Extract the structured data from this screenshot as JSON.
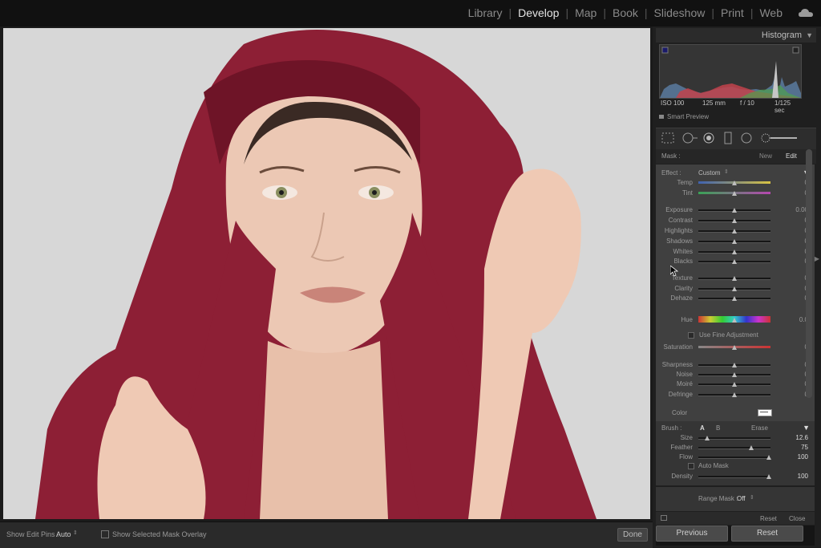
{
  "topbar": {
    "modules": [
      "Library",
      "Develop",
      "Map",
      "Book",
      "Slideshow",
      "Print",
      "Web"
    ],
    "active_module": "Develop",
    "cloud_icon": "cloud-icon"
  },
  "photo": {
    "background": "#d7d7d7",
    "scarf_color": "#8d1f35"
  },
  "bottombar": {
    "edit_pins_label": "Show Edit Pins :",
    "edit_pins_value": "Auto",
    "mask_overlay_label": "Show Selected Mask Overlay",
    "done_label": "Done"
  },
  "histogram": {
    "title": "Histogram",
    "iso": "ISO 100",
    "focal": "125 mm",
    "aperture": "f / 10",
    "shutter": "1/125 sec",
    "smart_preview": "Smart Preview"
  },
  "mask": {
    "label": "Mask :",
    "new_label": "New",
    "edit_label": "Edit"
  },
  "effect": {
    "label": "Effect :",
    "value": "Custom"
  },
  "sliders": [
    {
      "label": "Temp",
      "value": "0"
    },
    {
      "label": "Tint",
      "value": "0"
    },
    {
      "label": "Exposure",
      "value": "0.00"
    },
    {
      "label": "Contrast",
      "value": "0"
    },
    {
      "label": "Highlights",
      "value": "0"
    },
    {
      "label": "Shadows",
      "value": "0"
    },
    {
      "label": "Whites",
      "value": "0"
    },
    {
      "label": "Blacks",
      "value": "0"
    },
    {
      "label": "Texture",
      "value": "0"
    },
    {
      "label": "Clarity",
      "value": "0"
    },
    {
      "label": "Dehaze",
      "value": "0"
    },
    {
      "label": "Hue",
      "value": "0.0"
    },
    {
      "label": "Saturation",
      "value": "0"
    },
    {
      "label": "Sharpness",
      "value": "0"
    },
    {
      "label": "Noise",
      "value": "0"
    },
    {
      "label": "Moiré",
      "value": "0"
    },
    {
      "label": "Defringe",
      "value": "0"
    }
  ],
  "fine_adjust_label": "Use Fine Adjustment",
  "color_label": "Color",
  "brush": {
    "label": "Brush :",
    "a_label": "A",
    "b_label": "B",
    "erase_label": "Erase",
    "size_label": "Size",
    "size_value": "12.6",
    "feather_label": "Feather",
    "feather_value": "75",
    "flow_label": "Flow",
    "flow_value": "100",
    "automask_label": "Auto Mask",
    "density_label": "Density",
    "density_value": "100"
  },
  "range_mask": {
    "label": "Range Mask :",
    "value": "Off"
  },
  "panel_footer": {
    "reset_label": "Reset",
    "close_label": "Close"
  },
  "bottom_buttons": {
    "previous_label": "Previous",
    "reset_label": "Reset"
  }
}
